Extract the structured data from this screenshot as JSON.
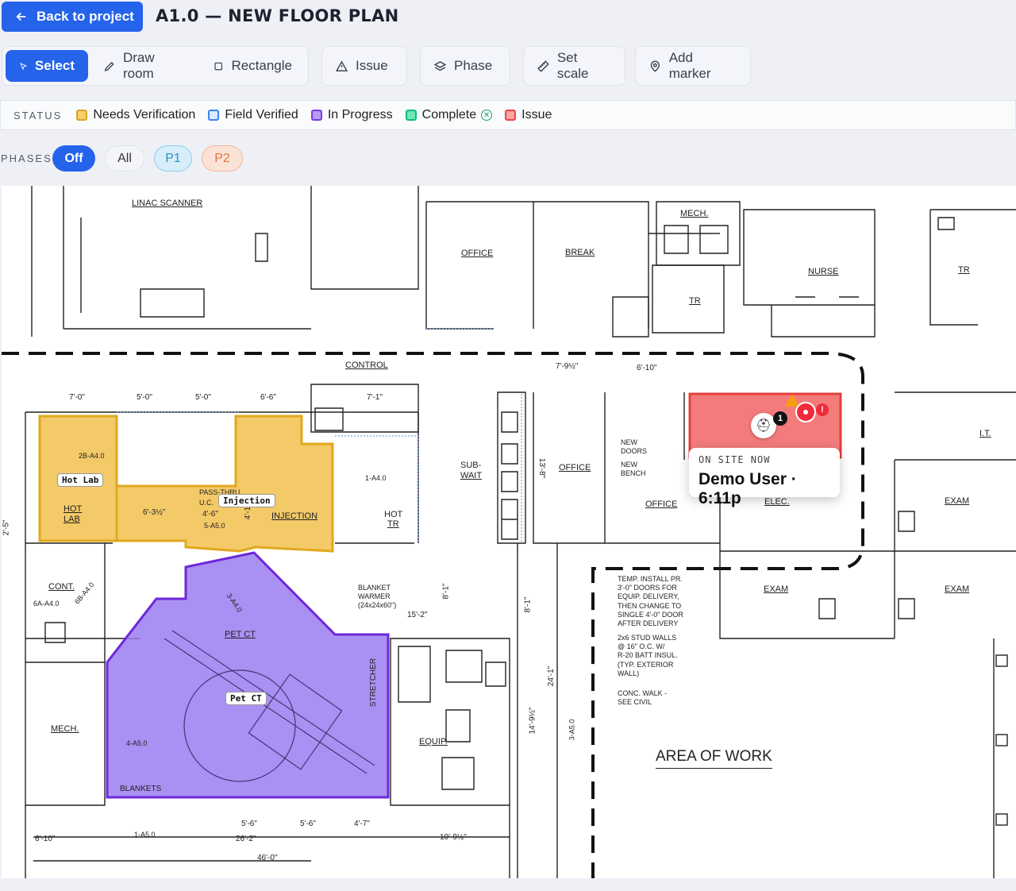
{
  "header": {
    "back_label": "Back to project",
    "title": "A1.0 — NEW FLOOR PLAN"
  },
  "toolbar": {
    "select": "Select",
    "draw_room": "Draw room",
    "rectangle": "Rectangle",
    "issue": "Issue",
    "phase": "Phase",
    "set_scale": "Set scale",
    "add_marker": "Add marker"
  },
  "status": {
    "label": "STATUS",
    "items": [
      {
        "label": "Needs Verification",
        "color": "#f2c14e"
      },
      {
        "label": "Field Verified",
        "color": "#3b82f6"
      },
      {
        "label": "In Progress",
        "color": "#8b5cf6"
      },
      {
        "label": "Complete",
        "color": "#22c58b"
      },
      {
        "label": "Issue",
        "color": "#ef4444"
      }
    ]
  },
  "phases": {
    "label": "PHASES",
    "off": "Off",
    "all": "All",
    "p1": "P1",
    "p2": "P2"
  },
  "plan": {
    "rooms": {
      "hot_lab": "Hot Lab",
      "injection": "Injection",
      "pet_ct": "Pet CT"
    },
    "presence": {
      "heading": "ON SITE NOW",
      "user": "Demo User · 6:11p",
      "badge_count": "1"
    },
    "labels": {
      "linac": "LINAC SCANNER",
      "office1": "OFFICE",
      "break": "BREAK",
      "mech_top": "MECH.",
      "tr_top": "TR",
      "nurse": "NURSE",
      "tr_right": "TR",
      "control": "CONTROL",
      "sub_wait": "SUB-",
      "sub_wait2": "WAIT",
      "office2": "OFFICE",
      "office3": "OFFICE",
      "new_doors": "NEW",
      "new_doors2": "DOORS",
      "new_bench": "NEW",
      "new_bench2": "BENCH",
      "elec": "ELEC.",
      "it": "I.T.",
      "exam1": "EXAM",
      "exam2": "EXAM",
      "exam3": "EXAM",
      "hot_lab_txt": "HOT",
      "hot_lab_txt2": "LAB",
      "injection_txt": "INJECTION",
      "hot_tr": "HOT",
      "hot_tr2": "TR",
      "cont": "CONT.",
      "mech_left": "MECH.",
      "pet_ct_txt": "PET CT",
      "stretcher": "STRETCHER",
      "equip": "EQUIP.",
      "blankets": "BLANKETS",
      "blanket_warmer": "BLANKET",
      "blanket_warmer2": "WARMER",
      "blanket_warmer3": "(24x24x60\")",
      "temp_install": "TEMP. INSTALL PR.",
      "temp_install2": "3'-0\" DOORS FOR",
      "temp_install3": "EQUIP. DELIVERY,",
      "temp_install4": "THEN CHANGE TO",
      "temp_install5": "SINGLE 4'-0\" DOOR",
      "temp_install6": "AFTER DELIVERY",
      "stud": "2x6 STUD WALLS",
      "stud2": "@ 16\" O.C. W/",
      "stud3": "R-20 BATT INSUL.",
      "stud4": "(TYP. EXTERIOR",
      "stud5": "WALL)",
      "conc": "CONC. WALK -",
      "conc2": "SEE CIVIL",
      "area_of_work": "AREA OF WORK",
      "pass_thru": "PASS-THRU",
      "uc": "U.C."
    },
    "dims": {
      "d1": "7'-0\"",
      "d2": "5'-0\"",
      "d3": "5'-0\"",
      "d4": "6'-6\"",
      "d5": "7'-1\"",
      "d6": "7'-9½\"",
      "d7": "6'-10\"",
      "d8": "15'-2\"",
      "d9": "8'-1\"",
      "d10": "13'-8\"",
      "d11": "5'-6\"",
      "d12": "5'-6\"",
      "d13": "4'-7\"",
      "d14": "26'-2\"",
      "d15": "46'-0\"",
      "d16": "6'-10\"",
      "d17": "10'-9½\"",
      "d18": "24'-1\"",
      "d19": "14'-9½\"",
      "d20": "6'-3½\"",
      "d21": "4'-6\"",
      "d22": "4'-10\"",
      "d23": "2'-5\"",
      "d24": "8'-1\""
    },
    "refs": {
      "r1": "2B-A4.0",
      "r2": "1-A4.0",
      "r3": "5-A5.0",
      "r4": "6A-A4.0",
      "r5": "6B-A4.0",
      "r6": "3-A4.0",
      "r7": "4-A5.0",
      "r8": "1-A5.0",
      "r9": "3-A5.0"
    }
  }
}
